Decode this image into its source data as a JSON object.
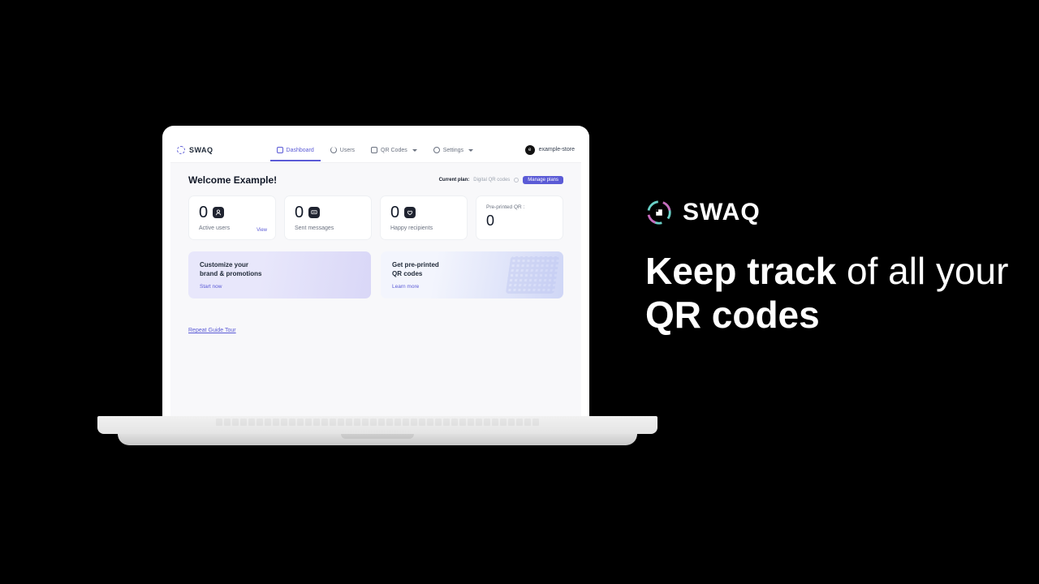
{
  "brand": "SWAQ",
  "tagline": {
    "part1": "Keep track",
    "part2": " of all your ",
    "part3": "QR codes"
  },
  "nav": {
    "dashboard": "Dashboard",
    "users": "Users",
    "qrcodes": "QR Codes",
    "settings": "Settings"
  },
  "user": {
    "store": "example-store",
    "initial": "e"
  },
  "header": {
    "welcome": "Welcome Example!",
    "currentPlanLabel": "Current plan:",
    "currentPlanName": "Digital QR codes",
    "manage": "Manage plans"
  },
  "stats": {
    "activeUsers": {
      "value": "0",
      "label": "Active users",
      "view": "View"
    },
    "sentMessages": {
      "value": "0",
      "label": "Sent messages"
    },
    "happyRecipients": {
      "value": "0",
      "label": "Happy recipients"
    },
    "preprinted": {
      "label": "Pre-printed QR :",
      "value": "0"
    }
  },
  "promos": {
    "customize": {
      "line1": "Customize your",
      "line2": "brand & promotions",
      "cta": "Start now"
    },
    "preprinted": {
      "line1": "Get pre-printed",
      "line2": "QR codes",
      "cta": "Learn more"
    }
  },
  "repeatTour": "Repeat Guide Tour"
}
